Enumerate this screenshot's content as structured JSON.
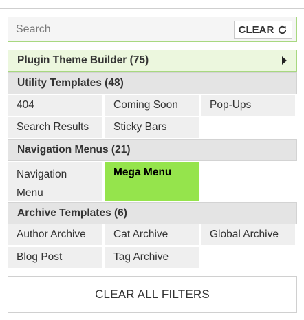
{
  "search": {
    "placeholder": "Search",
    "clear_label": "CLEAR"
  },
  "groups": {
    "plugin_theme_builder": {
      "label": "Plugin Theme Builder (75)"
    },
    "utility_templates": {
      "label": "Utility Templates (48)",
      "items": [
        "404",
        "Coming Soon",
        "Pop-Ups",
        "Search Results",
        "Sticky Bars"
      ]
    },
    "navigation_menus": {
      "label": "Navigation Menus (21)",
      "items": [
        "Navigation Menu",
        "Mega Menu"
      ],
      "selected": "Mega Menu"
    },
    "archive_templates": {
      "label": "Archive Templates (6)",
      "items": [
        "Author Archive",
        "Cat Archive",
        "Global Archive",
        "Blog Post",
        "Tag Archive"
      ]
    }
  },
  "clear_all_label": "CLEAR ALL FILTERS",
  "colors": {
    "accent": "#95e44c",
    "header_green_bg": "#ecf7de",
    "header_bg": "#e4e4e4"
  }
}
